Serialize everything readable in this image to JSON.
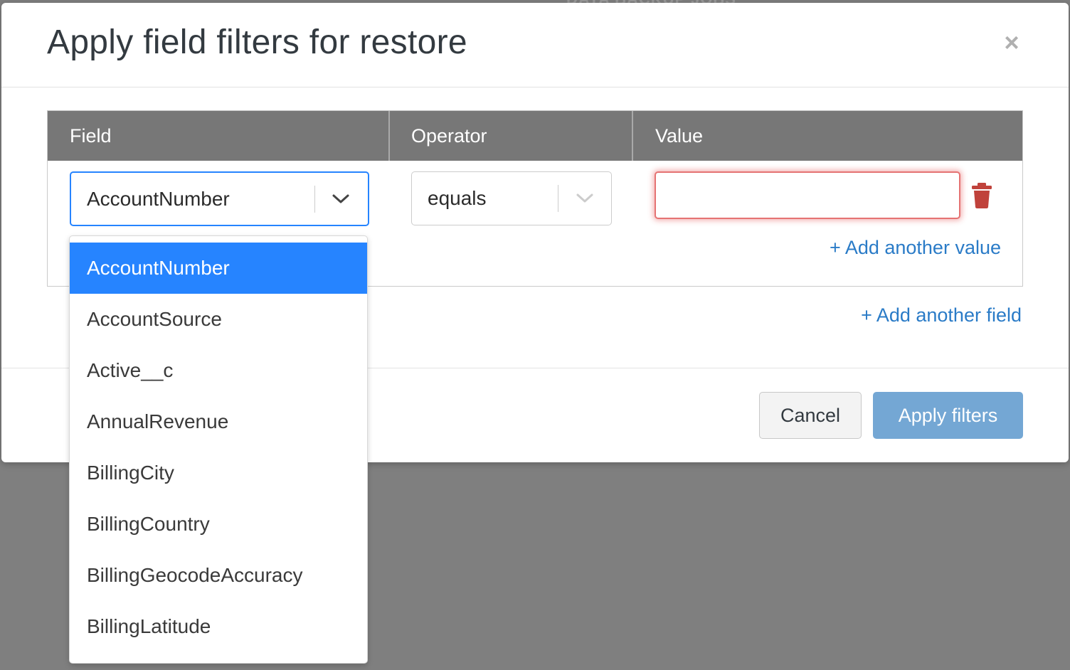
{
  "background": {
    "partial_text": "DATA BACKUP JOBS"
  },
  "modal": {
    "title": "Apply field filters for restore",
    "close_symbol": "×",
    "table": {
      "headers": {
        "field": "Field",
        "operator": "Operator",
        "value": "Value"
      },
      "row": {
        "field_value": "AccountNumber",
        "operator_value": "equals",
        "value_input": "",
        "value_state": "invalid"
      },
      "add_value_label": "+ Add another value"
    },
    "add_field_label": "+ Add another field",
    "buttons": {
      "cancel": "Cancel",
      "apply": "Apply filters"
    }
  },
  "field_dropdown": {
    "open": true,
    "options": [
      "AccountNumber",
      "AccountSource",
      "Active__c",
      "AnnualRevenue",
      "BillingCity",
      "BillingCountry",
      "BillingGeocodeAccuracy",
      "BillingLatitude"
    ],
    "selected_index": 0
  },
  "colors": {
    "overlay": "#7f7f7f",
    "header_bg": "#777777",
    "focus_blue": "#2684ff",
    "link_blue": "#2a7bc7",
    "error_red": "#e57373",
    "trash_red": "#c0423b",
    "apply_button": "#74a7d4"
  },
  "icons": {
    "close": "close-icon",
    "field_chevron": "chevron-down-icon",
    "operator_chevron": "chevron-down-icon",
    "delete": "trash-icon"
  }
}
